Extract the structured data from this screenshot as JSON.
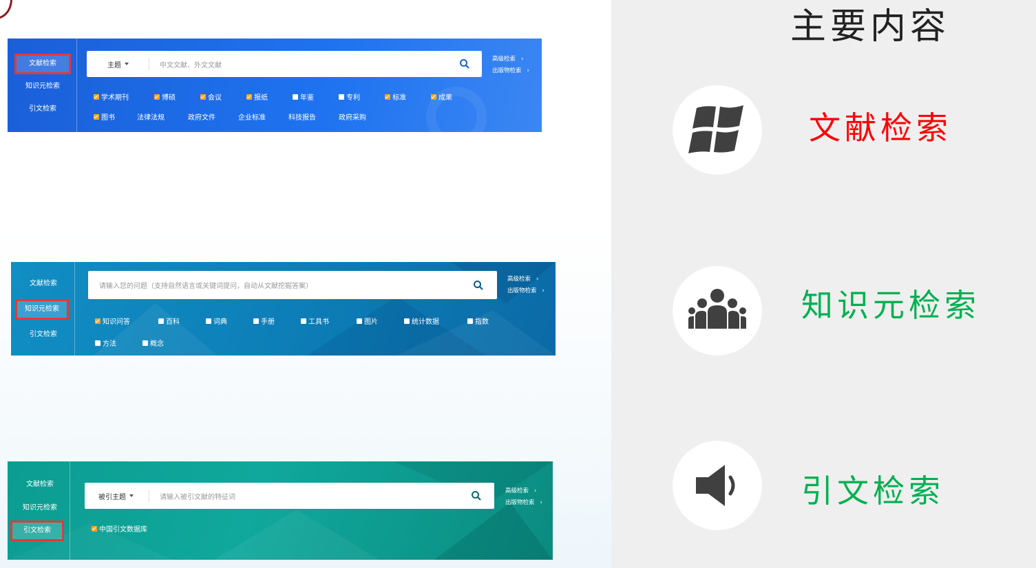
{
  "colors": {
    "red": "#ff0000",
    "green": "#00b050",
    "panel1": "#1f6fe8",
    "panel2": "#0e82ba",
    "panel3": "#0fa396",
    "checked": "#f5a623"
  },
  "panel1": {
    "nav": [
      "文献检索",
      "知识元检索",
      "引文检索"
    ],
    "active": 0,
    "scope": "主题",
    "placeholder": "中文文献、外文文献",
    "links": [
      "高级检索",
      "出版物检索"
    ],
    "options_row1": [
      {
        "label": "学术期刊",
        "checked": true
      },
      {
        "label": "博硕",
        "checked": true
      },
      {
        "label": "会议",
        "checked": true
      },
      {
        "label": "报纸",
        "checked": true
      },
      {
        "label": "年鉴",
        "checked": false
      },
      {
        "label": "专利",
        "checked": false
      },
      {
        "label": "标准",
        "checked": true
      },
      {
        "label": "成果",
        "checked": true
      }
    ],
    "options_row2": [
      {
        "label": "图书",
        "checked": true,
        "box": true
      },
      {
        "label": "法律法规",
        "box": false
      },
      {
        "label": "政府文件",
        "box": false
      },
      {
        "label": "企业标准",
        "box": false
      },
      {
        "label": "科技报告",
        "box": false
      },
      {
        "label": "政府采购",
        "box": false
      }
    ]
  },
  "panel2": {
    "nav": [
      "文献检索",
      "知识元检索",
      "引文检索"
    ],
    "active": 1,
    "placeholder": "请输入您的问题（支持自然语言或关键词提问，自动从文献挖掘答案）",
    "links": [
      "高级检索",
      "出版物检索"
    ],
    "options_row1": [
      {
        "label": "知识问答",
        "checked": true
      },
      {
        "label": "百科",
        "checked": false
      },
      {
        "label": "词典",
        "checked": false
      },
      {
        "label": "手册",
        "checked": false
      },
      {
        "label": "工具书",
        "checked": false
      },
      {
        "label": "图片",
        "checked": false
      },
      {
        "label": "统计数据",
        "checked": false
      },
      {
        "label": "指数",
        "checked": false
      }
    ],
    "options_row2": [
      {
        "label": "方法",
        "checked": false
      },
      {
        "label": "概念",
        "checked": false
      }
    ]
  },
  "panel3": {
    "nav": [
      "文献检索",
      "知识元检索",
      "引文检索"
    ],
    "active": 2,
    "scope": "被引主题",
    "placeholder": "请输入被引文献的特征词",
    "links": [
      "高级检索",
      "出版物检索"
    ],
    "options_row1": [
      {
        "label": "中国引文数据库",
        "checked": true
      }
    ]
  },
  "sidebar": {
    "title": "主要内容",
    "items": [
      {
        "label": "文献检索",
        "icon": "windows-icon",
        "color": "#ff0000"
      },
      {
        "label": "知识元检索",
        "icon": "group-icon",
        "color": "#00b050"
      },
      {
        "label": "引文检索",
        "icon": "speaker-icon",
        "color": "#00b050"
      }
    ]
  }
}
